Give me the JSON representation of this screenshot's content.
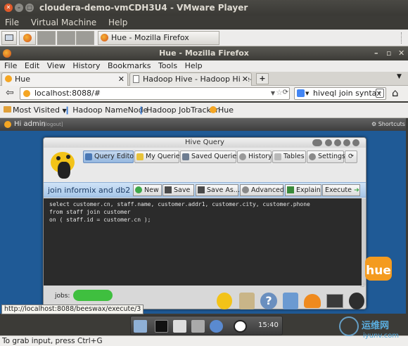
{
  "vmware": {
    "title": "cloudera-demo-vmCDH3U4 - VMware Player",
    "menu": [
      "File",
      "Virtual Machine",
      "Help"
    ],
    "taskbar_item": "Hue - Mozilla Firefox"
  },
  "firefox": {
    "title": "Hue - Mozilla Firefox",
    "menu": [
      "File",
      "Edit",
      "View",
      "History",
      "Bookmarks",
      "Tools",
      "Help"
    ],
    "tabs": [
      {
        "label": "Hue"
      },
      {
        "label": "Hadoop Hive - Hadoop Hive- J..."
      }
    ],
    "url": "localhost:8088/#",
    "search": "hiveql join syntax",
    "bookmarks": [
      "Most Visited",
      "Hadoop NameNode",
      "Hadoop JobTracker",
      "Hue"
    ]
  },
  "hue": {
    "greeting": "Hi admin",
    "logout": "[logout]",
    "shortcuts": "Shortcuts",
    "window_title": "Hive Query",
    "nav": [
      "Query Editor",
      "My Queries",
      "Saved Queries",
      "History",
      "Tables",
      "Settings"
    ],
    "query_name": "join informix and db2",
    "actions": [
      "New",
      "Save",
      "Save As...",
      "Advanced",
      "Explain",
      "Execute"
    ],
    "query_lines": [
      "select customer.cn, staff.name, customer.addr1, customer.city, customer.phone",
      "from staff join customer",
      "on ( staff.id = customer.cn );"
    ],
    "jobs_label": "jobs:",
    "hue_logo": "hue"
  },
  "tooltip": "http://localhost:8088/beeswax/execute/3",
  "clock": "15:40",
  "statusbar": "To grab input, press Ctrl+G",
  "watermark_cn": "运维网",
  "watermark_url": "iyunv.com",
  "colors": {
    "desktop": "#1f5a96",
    "editor_bg": "#2b2b2b",
    "accent": "#90c0ea"
  }
}
